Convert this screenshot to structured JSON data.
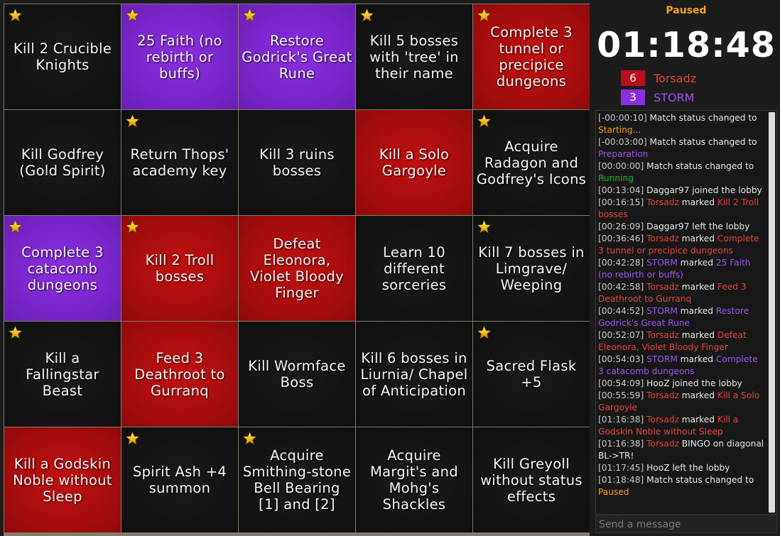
{
  "colors": {
    "red": "#b8101c",
    "purple": "#8a2ee0",
    "paused": "#f7a21a",
    "running": "#22b33a"
  },
  "board": {
    "cells": [
      {
        "text": "Kill 2 Crucible Knights",
        "owner": "none",
        "star": true
      },
      {
        "text": "25 Faith (no rebirth or buffs)",
        "owner": "purple",
        "star": true
      },
      {
        "text": "Restore Godrick's Great Rune",
        "owner": "purple",
        "star": true
      },
      {
        "text": "Kill 5 bosses with 'tree' in their name",
        "owner": "none",
        "star": true
      },
      {
        "text": "Complete 3 tunnel or precipice dungeons",
        "owner": "red",
        "star": true
      },
      {
        "text": "Kill Godfrey (Gold Spirit)",
        "owner": "none",
        "star": false
      },
      {
        "text": "Return Thops' academy key",
        "owner": "none",
        "star": true
      },
      {
        "text": "Kill 3 ruins bosses",
        "owner": "none",
        "star": false
      },
      {
        "text": "Kill a Solo Gargoyle",
        "owner": "red",
        "star": false
      },
      {
        "text": "Acquire Radagon and Godfrey's Icons",
        "owner": "none",
        "star": true
      },
      {
        "text": "Complete 3 catacomb dungeons",
        "owner": "purple",
        "star": true
      },
      {
        "text": "Kill 2 Troll bosses",
        "owner": "red",
        "star": true
      },
      {
        "text": "Defeat Eleonora, Violet Bloody Finger",
        "owner": "red",
        "star": false
      },
      {
        "text": "Learn 10 different sorceries",
        "owner": "none",
        "star": false
      },
      {
        "text": "Kill 7 bosses in Limgrave/ Weeping",
        "owner": "none",
        "star": true
      },
      {
        "text": "Kill a Fallingstar Beast",
        "owner": "none",
        "star": true
      },
      {
        "text": "Feed 3 Deathroot to Gurranq",
        "owner": "red",
        "star": false
      },
      {
        "text": "Kill Wormface Boss",
        "owner": "none",
        "star": false
      },
      {
        "text": "Kill 6 bosses in Liurnia/ Chapel of Anticipation",
        "owner": "none",
        "star": false
      },
      {
        "text": "Sacred Flask +5",
        "owner": "none",
        "star": true
      },
      {
        "text": "Kill a Godskin Noble without Sleep",
        "owner": "red",
        "star": false
      },
      {
        "text": "Spirit Ash +4 summon",
        "owner": "none",
        "star": true
      },
      {
        "text": "Acquire Smithing-stone Bell Bearing [1] and [2]",
        "owner": "none",
        "star": true
      },
      {
        "text": "Acquire Margit's and Mohg's Shackles",
        "owner": "none",
        "star": false
      },
      {
        "text": "Kill Greyoll without status effects",
        "owner": "none",
        "star": false
      }
    ]
  },
  "match": {
    "status": "Paused",
    "timer": "01:18:48"
  },
  "teams": [
    {
      "score": "6",
      "name": "Torsadz",
      "color": "red"
    },
    {
      "score": "3",
      "name": "STORM",
      "color": "purple"
    }
  ],
  "log": [
    {
      "ts": "[-00:00:10]",
      "parts": [
        {
          "t": " Match status changed to ",
          "c": ""
        },
        {
          "t": "Starting...",
          "c": "orange"
        }
      ]
    },
    {
      "ts": "[-00:03:00]",
      "parts": [
        {
          "t": " Match status changed to ",
          "c": ""
        },
        {
          "t": "Preparation",
          "c": "purple"
        }
      ]
    },
    {
      "ts": "[00:00:00]",
      "parts": [
        {
          "t": " Match status changed to ",
          "c": ""
        },
        {
          "t": "Running",
          "c": "green"
        }
      ]
    },
    {
      "ts": "[00:13:04]",
      "parts": [
        {
          "t": " Daggar97 joined the lobby",
          "c": ""
        }
      ]
    },
    {
      "ts": "[00:16:15]",
      "parts": [
        {
          "t": " Torsadz",
          "c": "red"
        },
        {
          "t": " marked ",
          "c": ""
        },
        {
          "t": "Kill 2 Troll bosses",
          "c": "red"
        }
      ]
    },
    {
      "ts": "[00:26:09]",
      "parts": [
        {
          "t": " Daggar97 left the lobby",
          "c": ""
        }
      ]
    },
    {
      "ts": "[00:36:46]",
      "parts": [
        {
          "t": " Torsadz",
          "c": "red"
        },
        {
          "t": " marked ",
          "c": ""
        },
        {
          "t": "Complete 3 tunnel or precipice dungeons",
          "c": "red"
        }
      ]
    },
    {
      "ts": "[00:42:28]",
      "parts": [
        {
          "t": " STORM",
          "c": "purple"
        },
        {
          "t": " marked ",
          "c": ""
        },
        {
          "t": "25 Faith (no rebirth or buffs)",
          "c": "purple"
        }
      ]
    },
    {
      "ts": "[00:42:58]",
      "parts": [
        {
          "t": " Torsadz",
          "c": "red"
        },
        {
          "t": " marked ",
          "c": ""
        },
        {
          "t": "Feed 3 Deathroot to Gurranq",
          "c": "red"
        }
      ]
    },
    {
      "ts": "[00:44:52]",
      "parts": [
        {
          "t": " STORM",
          "c": "purple"
        },
        {
          "t": " marked ",
          "c": ""
        },
        {
          "t": "Restore Godrick's Great Rune",
          "c": "purple"
        }
      ]
    },
    {
      "ts": "[00:52:07]",
      "parts": [
        {
          "t": " Torsadz",
          "c": "red"
        },
        {
          "t": " marked ",
          "c": ""
        },
        {
          "t": "Defeat Eleonora, Violet Bloody Finger",
          "c": "red"
        }
      ]
    },
    {
      "ts": "[00:54:03]",
      "parts": [
        {
          "t": " STORM",
          "c": "purple"
        },
        {
          "t": " marked ",
          "c": ""
        },
        {
          "t": "Complete 3 catacomb dungeons",
          "c": "purple"
        }
      ]
    },
    {
      "ts": "[00:54:09]",
      "parts": [
        {
          "t": " HooZ joined the lobby",
          "c": ""
        }
      ]
    },
    {
      "ts": "[00:55:59]",
      "parts": [
        {
          "t": " Torsadz",
          "c": "red"
        },
        {
          "t": " marked ",
          "c": ""
        },
        {
          "t": "Kill a Solo Gargoyle",
          "c": "red"
        }
      ]
    },
    {
      "ts": "[01:16:38]",
      "parts": [
        {
          "t": " Torsadz",
          "c": "red"
        },
        {
          "t": " marked ",
          "c": ""
        },
        {
          "t": "Kill a Godskin Noble without Sleep",
          "c": "red"
        }
      ]
    },
    {
      "ts": "[01:16:38]",
      "parts": [
        {
          "t": " Torsadz",
          "c": "red"
        },
        {
          "t": " BINGO on diagonal BL->TR!",
          "c": ""
        }
      ]
    },
    {
      "ts": "[01:17:45]",
      "parts": [
        {
          "t": " HooZ left the lobby",
          "c": ""
        }
      ]
    },
    {
      "ts": "[01:18:48]",
      "parts": [
        {
          "t": " Match status changed to ",
          "c": ""
        },
        {
          "t": "Paused",
          "c": "orange"
        }
      ]
    }
  ],
  "chat": {
    "placeholder": "Send a message"
  },
  "icons": {
    "cell_marker": "star-icon"
  }
}
